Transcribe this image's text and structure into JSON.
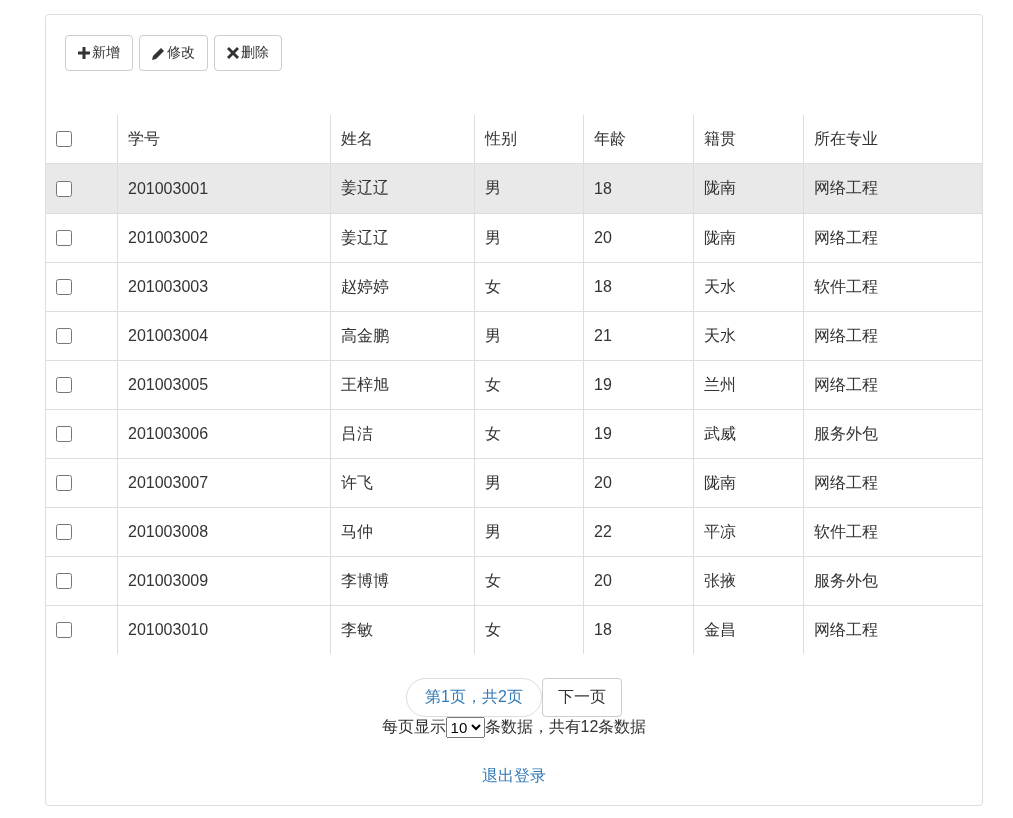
{
  "toolbar": [
    {
      "kind": "plus",
      "label": "新增"
    },
    {
      "kind": "pencil",
      "label": "修改"
    },
    {
      "kind": "cross",
      "label": "删除"
    }
  ],
  "table": {
    "select_all": {
      "checked": false
    },
    "columns": [
      "学号",
      "姓名",
      "性别",
      "年龄",
      "籍贯",
      "所在专业"
    ],
    "rows": [
      {
        "checked": false,
        "highlighted": true,
        "cells": [
          "201003001",
          "姜辽辽",
          "男",
          "18",
          "陇南",
          "网络工程"
        ]
      },
      {
        "checked": false,
        "highlighted": false,
        "cells": [
          "201003002",
          "姜辽辽",
          "男",
          "20",
          "陇南",
          "网络工程"
        ]
      },
      {
        "checked": false,
        "highlighted": false,
        "cells": [
          "201003003",
          "赵婷婷",
          "女",
          "18",
          "天水",
          "软件工程"
        ]
      },
      {
        "checked": false,
        "highlighted": false,
        "cells": [
          "201003004",
          "高金鹏",
          "男",
          "21",
          "天水",
          "网络工程"
        ]
      },
      {
        "checked": false,
        "highlighted": false,
        "cells": [
          "201003005",
          "王梓旭",
          "女",
          "19",
          "兰州",
          "网络工程"
        ]
      },
      {
        "checked": false,
        "highlighted": false,
        "cells": [
          "201003006",
          "吕洁",
          "女",
          "19",
          "武威",
          "服务外包"
        ]
      },
      {
        "checked": false,
        "highlighted": false,
        "cells": [
          "201003007",
          "许飞",
          "男",
          "20",
          "陇南",
          "网络工程"
        ]
      },
      {
        "checked": false,
        "highlighted": false,
        "cells": [
          "201003008",
          "马仲",
          "男",
          "22",
          "平凉",
          "软件工程"
        ]
      },
      {
        "checked": false,
        "highlighted": false,
        "cells": [
          "201003009",
          "李博博",
          "女",
          "20",
          "张掖",
          "服务外包"
        ]
      },
      {
        "checked": false,
        "highlighted": false,
        "cells": [
          "201003010",
          "李敏",
          "女",
          "18",
          "金昌",
          "网络工程"
        ]
      }
    ]
  },
  "pagination": {
    "page_info": "第1页，共2页",
    "next_button": "下一页"
  },
  "page_size": {
    "prefix": "每页显示",
    "value": "10",
    "suffix": "条数据，共有12条数据"
  },
  "logout_link": "退出登录"
}
